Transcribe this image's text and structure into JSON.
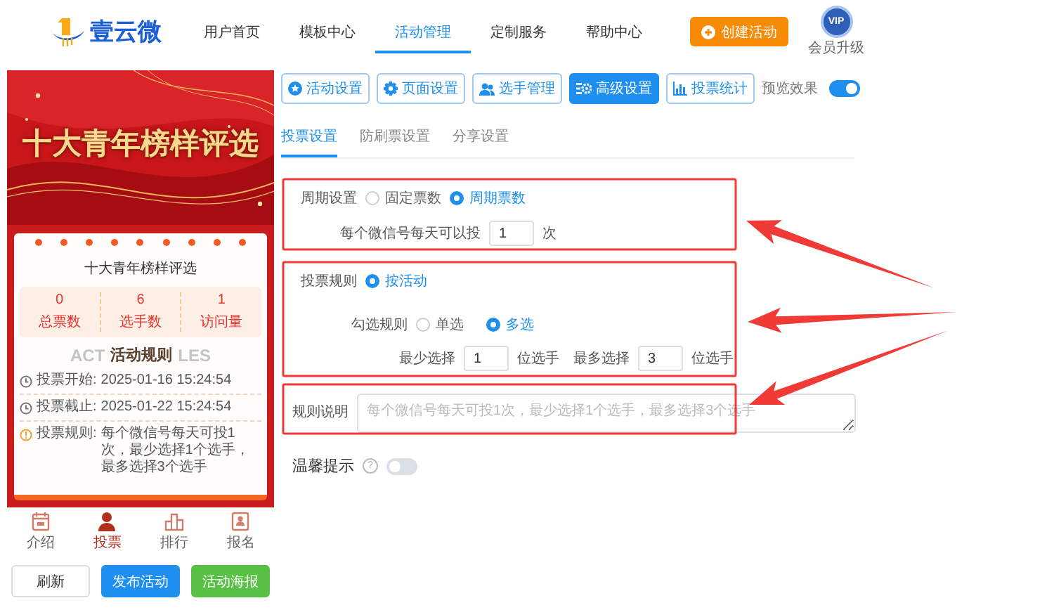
{
  "header": {
    "logo": "壹云微",
    "nav": [
      {
        "label": "用户首页",
        "selected": false
      },
      {
        "label": "模板中心",
        "selected": false
      },
      {
        "label": "活动管理",
        "selected": true
      },
      {
        "label": "定制服务",
        "selected": false
      },
      {
        "label": "帮助中心",
        "selected": false
      }
    ],
    "create_button": "创建活动",
    "vip_badge": "VIP",
    "vip_label": "会员升级"
  },
  "preview": {
    "banner_title": "十大青年榜样评选",
    "card_title": "十大青年榜样评选",
    "stats": [
      {
        "value": "0",
        "label": "总票数"
      },
      {
        "value": "6",
        "label": "选手数"
      },
      {
        "value": "1",
        "label": "访问量"
      }
    ],
    "rules_watermark_left": "ACT",
    "rules_title": "活动规则",
    "rules_watermark_right": "LES",
    "rules": [
      {
        "kind": "clock",
        "label": "投票开始:",
        "value": "2025-01-16 15:24:54"
      },
      {
        "kind": "clock",
        "label": "投票截止:",
        "value": "2025-01-22 15:24:54"
      },
      {
        "kind": "info",
        "label": "投票规则:",
        "value": "每个微信号每天可投1次，最少选择1个选手，最多选择3个选手"
      }
    ],
    "tabs": [
      {
        "kind": "calendar",
        "label": "介绍",
        "selected": false
      },
      {
        "kind": "person",
        "label": "投票",
        "selected": true
      },
      {
        "kind": "ranking",
        "label": "排行",
        "selected": false
      },
      {
        "kind": "form",
        "label": "报名",
        "selected": false
      }
    ]
  },
  "buttons": [
    {
      "kind": "plain",
      "label": "刷新"
    },
    {
      "kind": "primary",
      "label": "发布活动"
    },
    {
      "kind": "success",
      "label": "活动海报"
    }
  ],
  "settings": {
    "tool_tabs": [
      {
        "kind": "star",
        "label": "活动设置",
        "selected": false
      },
      {
        "kind": "gear",
        "label": "页面设置",
        "selected": false
      },
      {
        "kind": "people",
        "label": "选手管理",
        "selected": false
      },
      {
        "kind": "config",
        "label": "高级设置",
        "selected": true
      },
      {
        "kind": "chart",
        "label": "投票统计",
        "selected": false
      }
    ],
    "preview_toggle": {
      "label": "预览效果",
      "on": true
    },
    "sub_tabs": [
      {
        "label": "投票设置",
        "selected": true
      },
      {
        "label": "防刷票设置",
        "selected": false
      },
      {
        "label": "分享设置",
        "selected": false
      }
    ],
    "cycle": {
      "label": "周期设置",
      "options": [
        {
          "label": "固定票数",
          "selected": false
        },
        {
          "label": "周期票数",
          "selected": true
        }
      ],
      "per_day_label": "每个微信号每天可以投",
      "per_day_value": "1",
      "per_day_unit": "次"
    },
    "vote_rule": {
      "label": "投票规则",
      "options": [
        {
          "label": "按活动",
          "selected": true
        }
      ],
      "check_label": "勾选规则",
      "check_options": [
        {
          "label": "单选",
          "selected": false
        },
        {
          "label": "多选",
          "selected": true
        }
      ],
      "min_label": "最少选择",
      "min_value": "1",
      "min_unit": "位选手",
      "max_label": "最多选择",
      "max_value": "3",
      "max_unit": "位选手"
    },
    "rule_note": {
      "label": "规则说明",
      "placeholder": "每个微信号每天可投1次，最少选择1个选手，最多选择3个选手"
    },
    "tips": {
      "label": "温馨提示",
      "help": "?",
      "on": false
    }
  }
}
